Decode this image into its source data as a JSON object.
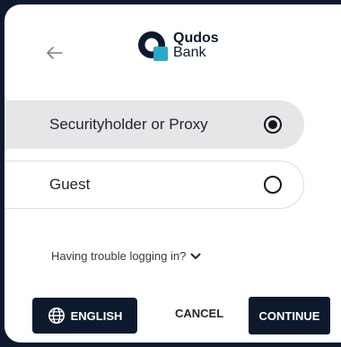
{
  "brand": {
    "name": "Qudos",
    "sub": "Bank",
    "primary_color": "#0d1a2d",
    "accent_color": "#2aa8c9"
  },
  "header": {
    "back_icon": "arrow-left-icon",
    "logo_icon": "qudos-logo-icon"
  },
  "options": [
    {
      "label": "Securityholder or Proxy",
      "selected": true
    },
    {
      "label": "Guest",
      "selected": false
    }
  ],
  "help": {
    "label": "Having trouble logging in?",
    "icon": "chevron-down-icon"
  },
  "footer": {
    "language_label": "ENGLISH",
    "language_icon": "globe-icon",
    "cancel_label": "CANCEL",
    "continue_label": "CONTINUE"
  }
}
